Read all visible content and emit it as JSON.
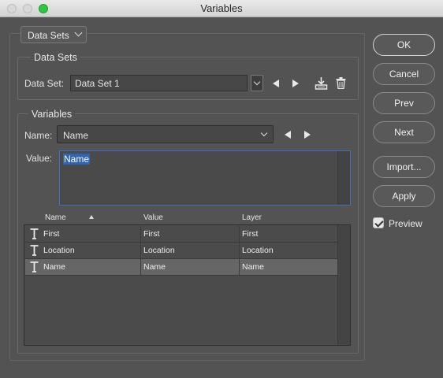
{
  "window": {
    "title": "Variables"
  },
  "mode_dropdown": {
    "label": "Data Sets"
  },
  "data_sets": {
    "group_title": "Data Sets",
    "field_label": "Data Set:",
    "value": "Data Set 1"
  },
  "variables": {
    "group_title": "Variables",
    "name_label": "Name:",
    "name_value": "Name",
    "value_label": "Value:",
    "value_text": "Name"
  },
  "table": {
    "columns": [
      "Name",
      "Value",
      "Layer"
    ],
    "rows": [
      {
        "name": "First",
        "value": "First",
        "layer": "First",
        "icon": "text-layer-icon"
      },
      {
        "name": "Location",
        "value": "Location",
        "layer": "Location",
        "icon": "text-layer-icon"
      },
      {
        "name": "Name",
        "value": "Name",
        "layer": "Name",
        "icon": "text-layer-icon",
        "selected": true
      }
    ]
  },
  "buttons": {
    "ok": "OK",
    "cancel": "Cancel",
    "prev": "Prev",
    "next": "Next",
    "import": "Import...",
    "apply": "Apply"
  },
  "preview": {
    "label": "Preview",
    "checked": true
  },
  "colors": {
    "background": "#535353",
    "focus": "#3f6fc0",
    "selection": "#2f64b7",
    "zoom_button": "#2bc840"
  }
}
